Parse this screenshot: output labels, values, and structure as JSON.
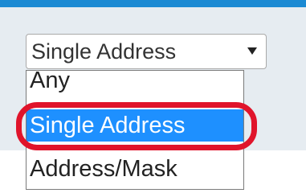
{
  "select": {
    "value": "Single Address",
    "arrow_icon": "triangle-down-icon"
  },
  "dropdown": {
    "options": [
      "Any",
      "Single Address",
      "Address/Mask"
    ],
    "highlighted_index": 1
  },
  "colors": {
    "top_bar": "#1b8ad3",
    "panel_bg": "#e6ecf1",
    "selected_option": "#1e90ff",
    "annotation_ring": "#e0142b"
  }
}
